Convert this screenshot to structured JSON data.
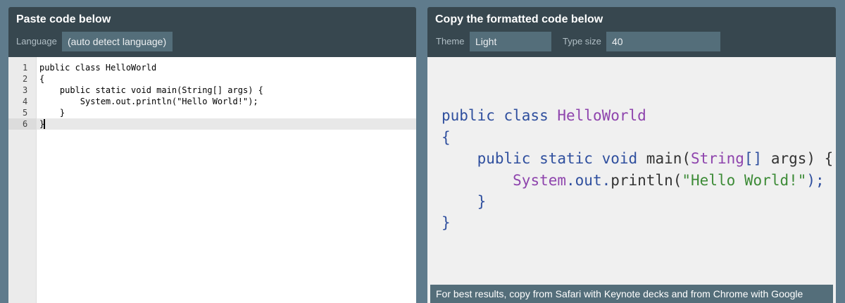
{
  "left_panel": {
    "title": "Paste code below",
    "language_label": "Language",
    "language_value": "(auto detect language)"
  },
  "editor": {
    "line_numbers": [
      "1",
      "2",
      "3",
      "4",
      "5",
      "6"
    ],
    "lines": [
      "public class HelloWorld",
      "{",
      "    public static void main(String[] args) {",
      "        System.out.println(\"Hello World!\");",
      "    }",
      "}"
    ],
    "active_line": 6
  },
  "right_panel": {
    "title": "Copy the formatted code below",
    "theme_label": "Theme",
    "theme_value": "Light",
    "type_size_label": "Type size",
    "type_size_value": "40"
  },
  "formatted": {
    "l1": {
      "kw": "public class ",
      "cls": "HelloWorld"
    },
    "l2": {
      "pl": "{"
    },
    "l3": {
      "kw": "public static void ",
      "pl_a": "main(",
      "cls": "String",
      "kw_b": "[] ",
      "pl_b": "args) {"
    },
    "l4": {
      "cls": "System",
      "kw_a": ".out.",
      "pl_a": "println(",
      "str": "\"Hello World!\"",
      "pl_b": ");"
    },
    "l5": {
      "pl": "}"
    },
    "l6": {
      "pl": "}"
    },
    "colors": {
      "keyword": "#2f4f9e",
      "class": "#8e44ad",
      "string": "#3d8b37",
      "plain": "#333333"
    }
  },
  "hint": "For best results, copy from Safari with Keynote decks and from Chrome with Google"
}
